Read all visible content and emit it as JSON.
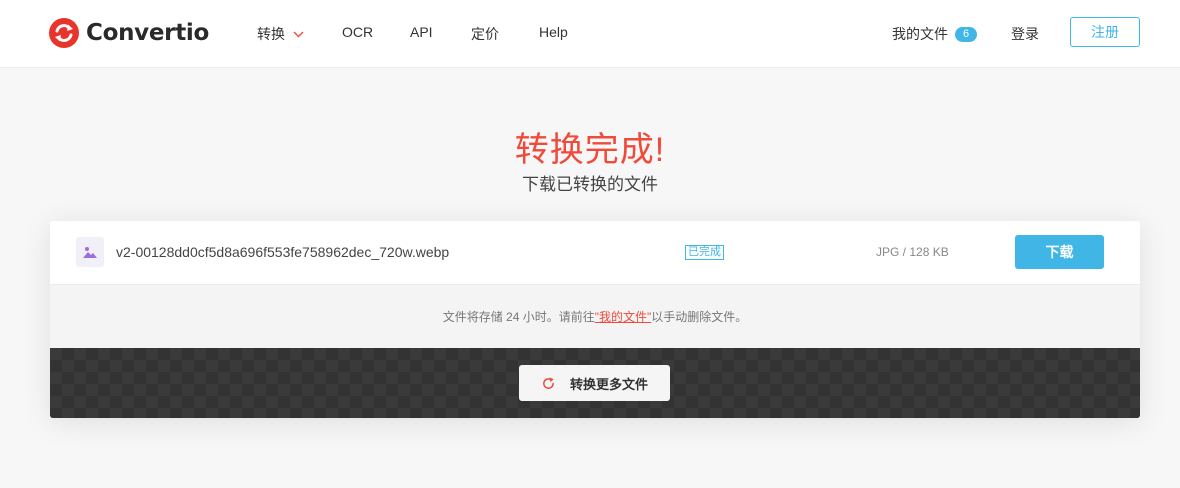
{
  "header": {
    "logo_text": "Convertio",
    "nav": {
      "convert_label": "转换",
      "ocr_label": "OCR",
      "api_label": "API",
      "pricing_label": "定价",
      "help_label": "Help"
    },
    "my_files_label": "我的文件",
    "my_files_count": "6",
    "login_label": "登录",
    "register_label": "注册"
  },
  "main": {
    "title": "转换完成!",
    "subtitle": "下载已转换的文件"
  },
  "file": {
    "name": "v2-00128dd0cf5d8a696f553fe758962dec_720w.webp",
    "status": "已完成",
    "meta": "JPG / 128 KB",
    "download_label": "下载"
  },
  "note": {
    "prefix": "文件将存储 24 小时。请前往",
    "link": "\"我的文件\"",
    "suffix": "以手动删除文件。"
  },
  "actions": {
    "convert_more_label": "转换更多文件"
  },
  "colors": {
    "accent": "#3fb6e6",
    "brand_red": "#f04a3b",
    "file_icon": "#9b6ee0"
  }
}
